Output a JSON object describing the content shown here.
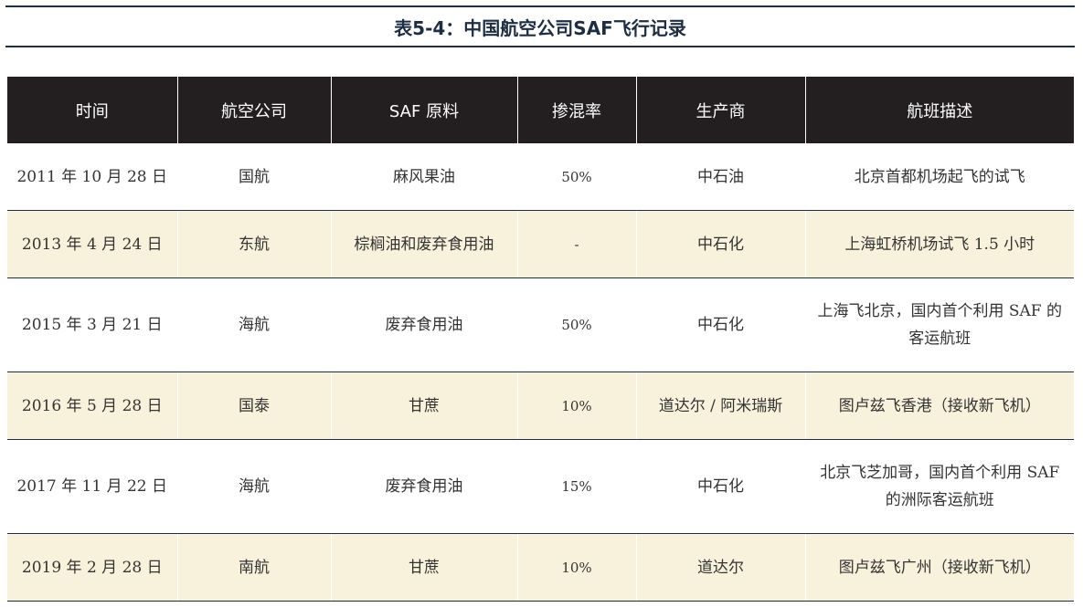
{
  "title": "表5-4：中国航空公司SAF飞行记录",
  "columns": [
    "时间",
    "航空公司",
    "SAF 原料",
    "掺混率",
    "生产商",
    "航班描述"
  ],
  "rows": [
    {
      "time": "2011 年 10 月 28 日",
      "airline": "国航",
      "feedstock": "麻风果油",
      "blend": "50%",
      "producer": "中石油",
      "description": "北京首都机场起飞的试飞"
    },
    {
      "time": "2013 年 4 月 24 日",
      "airline": "东航",
      "feedstock": "棕榈油和废弃食用油",
      "blend": "-",
      "producer": "中石化",
      "description": "上海虹桥机场试飞 1.5 小时"
    },
    {
      "time": "2015 年 3 月 21 日",
      "airline": "海航",
      "feedstock": "废弃食用油",
      "blend": "50%",
      "producer": "中石化",
      "description": "上海飞北京，国内首个利用 SAF 的客运航班"
    },
    {
      "time": "2016 年 5 月 28 日",
      "airline": "国泰",
      "feedstock": "甘蔗",
      "blend": "10%",
      "producer": "道达尔 / 阿米瑞斯",
      "description": "图卢兹飞香港（接收新飞机）"
    },
    {
      "time": "2017 年 11 月 22 日",
      "airline": "海航",
      "feedstock": "废弃食用油",
      "blend": "15%",
      "producer": "中石化",
      "description": "北京飞芝加哥，国内首个利用 SAF 的洲际客运航班"
    },
    {
      "time": "2019 年 2 月 28 日",
      "airline": "南航",
      "feedstock": "甘蔗",
      "blend": "10%",
      "producer": "道达尔",
      "description": "图卢兹飞广州（接收新飞机）"
    }
  ]
}
